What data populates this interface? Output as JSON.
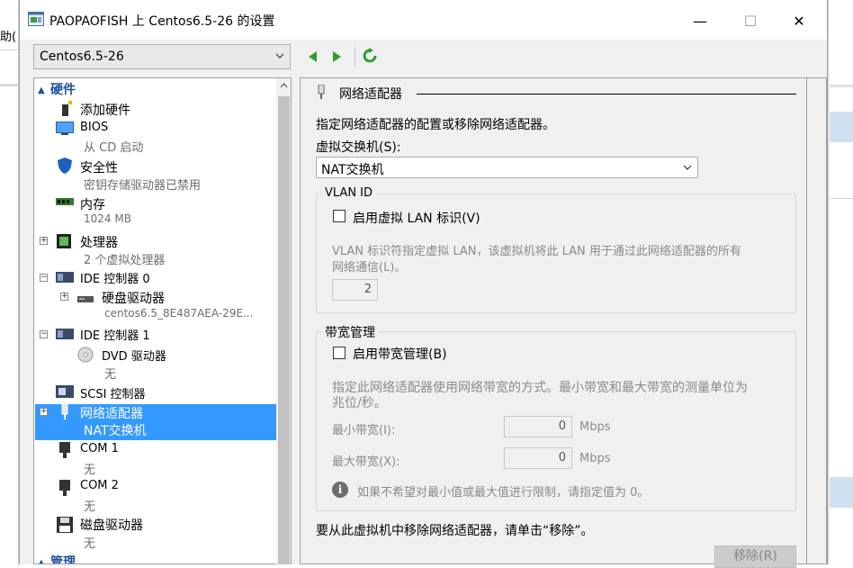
{
  "background": {
    "left_fragment": "助(",
    "accent_color": "#cfe0f1"
  },
  "window": {
    "title": "PAOPAOFISH 上 Centos6.5-26 的设置",
    "min_glyph": "—",
    "max_glyph": "☐",
    "close_glyph": "✕"
  },
  "vm_selector": {
    "value": "Centos6.5-26"
  },
  "tree": {
    "hardware_header": "硬件",
    "management_header": "管理",
    "items": {
      "add_hardware": {
        "label": "添加硬件"
      },
      "bios": {
        "label": "BIOS",
        "sub": "从 CD 启动"
      },
      "security": {
        "label": "安全性",
        "sub": "密钥存储驱动器已禁用"
      },
      "memory": {
        "label": "内存",
        "sub": "1024 MB"
      },
      "processor": {
        "label": "处理器",
        "sub": "2 个虚拟处理器"
      },
      "ide0": {
        "label": "IDE 控制器 0"
      },
      "hard_drive": {
        "label": "硬盘驱动器",
        "sub": "centos6.5_8E487AEA-29E..."
      },
      "ide1": {
        "label": "IDE 控制器 1"
      },
      "dvd": {
        "label": "DVD 驱动器",
        "sub": "无"
      },
      "scsi": {
        "label": "SCSI 控制器"
      },
      "network": {
        "label": "网络适配器",
        "sub": "NAT交换机"
      },
      "com1": {
        "label": "COM 1",
        "sub": "无"
      },
      "com2": {
        "label": "COM 2",
        "sub": "无"
      },
      "floppy": {
        "label": "磁盘驱动器",
        "sub": "无"
      }
    },
    "selection_color": "#3399ff"
  },
  "content": {
    "title": "网络适配器",
    "description": "指定网络适配器的配置或移除网络适配器。",
    "switch_label": "虚拟交换机(S):",
    "switch_value": "NAT交换机",
    "vlan": {
      "group_title": "VLAN ID",
      "checkbox_label": "启用虚拟 LAN 标识(V)",
      "desc_line1": "VLAN 标识符指定虚拟 LAN，该虚拟机将此 LAN 用于通过此网络适配器的所有",
      "desc_line2": "网络通信(L)。",
      "value": "2"
    },
    "bandwidth": {
      "group_title": "带宽管理",
      "checkbox_label": "启用带宽管理(B)",
      "desc_line1": "指定此网络适配器使用网络带宽的方式。最小带宽和最大带宽的测量单位为",
      "desc_line2": "兆位/秒。",
      "min_label": "最小带宽(I):",
      "min_value": "0",
      "max_label": "最大带宽(X):",
      "max_value": "0",
      "unit": "Mbps",
      "info": "如果不希望对最小值或最大值进行限制，请指定值为 0。"
    },
    "remove_text": "要从此虚拟机中移除网络适配器，请单击“移除”。",
    "remove_button": "移除(R)"
  }
}
